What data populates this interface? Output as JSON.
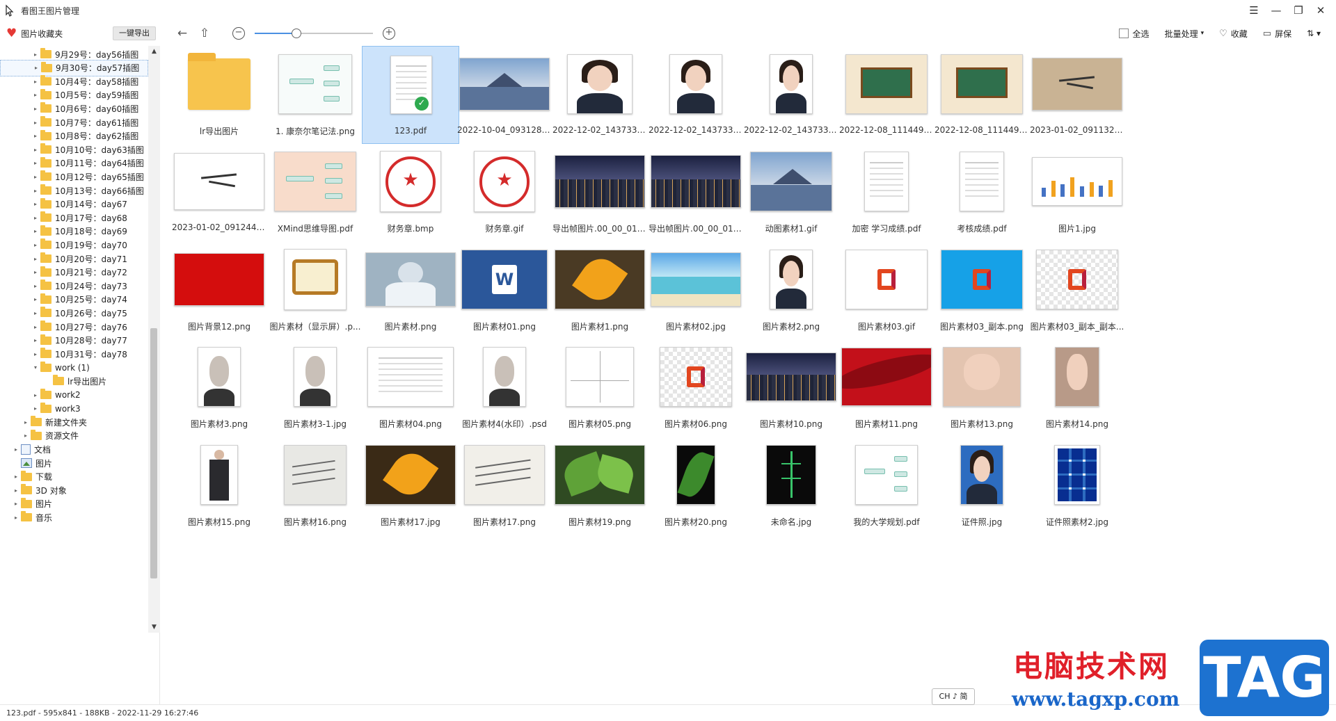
{
  "window": {
    "title": "看图王图片管理",
    "controls": [
      "☰",
      "—",
      "❐",
      "✕"
    ]
  },
  "toolbar": {
    "favorites_label": "图片收藏夹",
    "export_label": "一键导出",
    "zoom_percent": 35,
    "select_all_label": "全选",
    "batch_label": "批量处理",
    "batch_arrow": "▾",
    "collect_label": "收藏",
    "screen_label": "屏保",
    "sort_icon": "⇅ ▾"
  },
  "icons": {
    "back": "←",
    "up": "⇧",
    "zoom_out": "−",
    "zoom_in": "+",
    "heart": "♥",
    "heart_outline": "♡",
    "monitor": "▭",
    "expand": "▸",
    "collapse": "▾",
    "scroll_up": "▲",
    "scroll_down": "▼",
    "check": "✓"
  },
  "tree": [
    {
      "label": "9月29号：day56插图",
      "level": 3,
      "kind": "folder",
      "arrow": "▸"
    },
    {
      "label": "9月30号：day57插图",
      "level": 3,
      "kind": "folder",
      "arrow": "▸",
      "selected": true
    },
    {
      "label": "10月4号：day58插图",
      "level": 3,
      "kind": "folder",
      "arrow": "▸"
    },
    {
      "label": "10月5号：day59插图",
      "level": 3,
      "kind": "folder",
      "arrow": "▸"
    },
    {
      "label": "10月6号：day60插图",
      "level": 3,
      "kind": "folder",
      "arrow": "▸"
    },
    {
      "label": "10月7号：day61插图",
      "level": 3,
      "kind": "folder",
      "arrow": "▸"
    },
    {
      "label": "10月8号：day62插图",
      "level": 3,
      "kind": "folder",
      "arrow": "▸"
    },
    {
      "label": "10月10号：day63插图",
      "level": 3,
      "kind": "folder",
      "arrow": "▸"
    },
    {
      "label": "10月11号：day64插图",
      "level": 3,
      "kind": "folder",
      "arrow": "▸"
    },
    {
      "label": "10月12号：day65插图",
      "level": 3,
      "kind": "folder",
      "arrow": "▸"
    },
    {
      "label": "10月13号：day66插图",
      "level": 3,
      "kind": "folder",
      "arrow": "▸"
    },
    {
      "label": "10月14号：day67",
      "level": 3,
      "kind": "folder",
      "arrow": "▸"
    },
    {
      "label": "10月17号：day68",
      "level": 3,
      "kind": "folder",
      "arrow": "▸"
    },
    {
      "label": "10月18号：day69",
      "level": 3,
      "kind": "folder",
      "arrow": "▸"
    },
    {
      "label": "10月19号：day70",
      "level": 3,
      "kind": "folder",
      "arrow": "▸"
    },
    {
      "label": "10月20号：day71",
      "level": 3,
      "kind": "folder",
      "arrow": "▸"
    },
    {
      "label": "10月21号：day72",
      "level": 3,
      "kind": "folder",
      "arrow": "▸"
    },
    {
      "label": "10月24号：day73",
      "level": 3,
      "kind": "folder",
      "arrow": "▸"
    },
    {
      "label": "10月25号：day74",
      "level": 3,
      "kind": "folder",
      "arrow": "▸"
    },
    {
      "label": "10月26号：day75",
      "level": 3,
      "kind": "folder",
      "arrow": "▸"
    },
    {
      "label": "10月27号：day76",
      "level": 3,
      "kind": "folder",
      "arrow": "▸"
    },
    {
      "label": "10月28号：day77",
      "level": 3,
      "kind": "folder",
      "arrow": "▸"
    },
    {
      "label": "10月31号：day78",
      "level": 3,
      "kind": "folder",
      "arrow": "▸"
    },
    {
      "label": "work (1)",
      "level": 3,
      "kind": "folder",
      "arrow": "▾"
    },
    {
      "label": "lr导出图片",
      "level": 4,
      "kind": "folder",
      "arrow": ""
    },
    {
      "label": "work2",
      "level": 3,
      "kind": "folder",
      "arrow": "▸"
    },
    {
      "label": "work3",
      "level": 3,
      "kind": "folder",
      "arrow": "▸"
    },
    {
      "label": "新建文件夹",
      "level": 2,
      "kind": "folder",
      "arrow": "▸"
    },
    {
      "label": "资源文件",
      "level": 2,
      "kind": "folder",
      "arrow": "▸"
    },
    {
      "label": "文档",
      "level": 1,
      "kind": "doc",
      "arrow": "▸"
    },
    {
      "label": "图片",
      "level": 1,
      "kind": "pic",
      "arrow": ""
    },
    {
      "label": "下载",
      "level": 1,
      "kind": "folder",
      "arrow": "▸"
    },
    {
      "label": "3D 对象",
      "level": 1,
      "kind": "folder",
      "arrow": "▸"
    },
    {
      "label": "图片",
      "level": 1,
      "kind": "folder",
      "arrow": "▸"
    },
    {
      "label": "音乐",
      "level": 1,
      "kind": "folder",
      "arrow": "▸"
    }
  ],
  "files": [
    {
      "name": "lr导出图片",
      "kind": "folder"
    },
    {
      "name": "1. 康奈尔笔记法.png",
      "kind": "mindmap",
      "w": 106,
      "h": 86,
      "bg": "#f7fbfa"
    },
    {
      "name": "123.pdf",
      "kind": "pdf",
      "w": 60,
      "h": 84,
      "bg": "#ffffff",
      "selected": true
    },
    {
      "name": "2022-10-04_093128....",
      "kind": "landscape",
      "w": 136,
      "h": 76,
      "bg": "#6e90b8"
    },
    {
      "name": "2022-12-02_143733 ...",
      "kind": "portrait",
      "w": 94,
      "h": 86,
      "bg": "#ffffff"
    },
    {
      "name": "2022-12-02_143733.j...",
      "kind": "portrait",
      "w": 76,
      "h": 86,
      "bg": "#ffffff"
    },
    {
      "name": "2022-12-02_143733....",
      "kind": "portrait",
      "w": 62,
      "h": 86,
      "bg": "#ffffff"
    },
    {
      "name": "2022-12-08_111449....",
      "kind": "board",
      "w": 118,
      "h": 86,
      "bg": "#f4e7cf"
    },
    {
      "name": "2022-12-08_111449_...",
      "kind": "board",
      "w": 118,
      "h": 86,
      "bg": "#f4e7cf"
    },
    {
      "name": "2023-01-02_091132....",
      "kind": "sign",
      "w": 136,
      "h": 76,
      "bg": "#c9b394"
    },
    {
      "name": "2023-01-02_091244....",
      "kind": "sign",
      "w": 136,
      "h": 82,
      "bg": "#ffffff"
    },
    {
      "name": "XMind思维导图.pdf",
      "kind": "mindmap",
      "w": 118,
      "h": 86,
      "bg": "#f8dccb"
    },
    {
      "name": "财务章.bmp",
      "kind": "stamp",
      "w": 88,
      "h": 88,
      "bg": "#ffffff"
    },
    {
      "name": "财务章.gif",
      "kind": "stamp",
      "w": 88,
      "h": 88,
      "bg": "#ffffff"
    },
    {
      "name": "导出帧图片.00_00_01_...",
      "kind": "city",
      "w": 136,
      "h": 76,
      "bg": "#2c3556"
    },
    {
      "name": "导出帧图片.00_00_01_...",
      "kind": "city",
      "w": 136,
      "h": 76,
      "bg": "#2c3556"
    },
    {
      "name": "动图素材1.gif",
      "kind": "landscape",
      "w": 118,
      "h": 86,
      "bg": "#ffffff"
    },
    {
      "name": "加密 学习成绩.pdf",
      "kind": "pdf",
      "w": 64,
      "h": 86,
      "bg": "#ffffff"
    },
    {
      "name": "考核成绩.pdf",
      "kind": "pdf",
      "w": 64,
      "h": 86,
      "bg": "#ffffff"
    },
    {
      "name": "图片1.jpg",
      "kind": "chart",
      "w": 136,
      "h": 70,
      "bg": "#ffffff"
    },
    {
      "name": "图片背景12.png",
      "kind": "solid",
      "w": 136,
      "h": 76,
      "bg": "#d40d0d"
    },
    {
      "name": "图片素材（显示屏）.p...",
      "kind": "tv",
      "w": 90,
      "h": 88,
      "bg": "#ffffff"
    },
    {
      "name": "图片素材.png",
      "kind": "doctor",
      "w": 136,
      "h": 78,
      "bg": "#9fb3c2"
    },
    {
      "name": "图片素材01.png",
      "kind": "word",
      "w": 124,
      "h": 86,
      "bg": "#2b579a"
    },
    {
      "name": "图片素材1.png",
      "kind": "leaf",
      "w": 136,
      "h": 86,
      "bg": "#4a3a24"
    },
    {
      "name": "图片素材02.jpg",
      "kind": "beach",
      "w": 136,
      "h": 78,
      "bg": "#5bc2d8"
    },
    {
      "name": "图片素材2.png",
      "kind": "portrait",
      "w": 62,
      "h": 86,
      "bg": "#ffffff"
    },
    {
      "name": "图片素材03.gif",
      "kind": "office",
      "w": 118,
      "h": 86,
      "bg": "#ffffff"
    },
    {
      "name": "图片素材03_副本.png",
      "kind": "office",
      "w": 118,
      "h": 86,
      "bg": "#16a1e7"
    },
    {
      "name": "图片素材03_副本_副本...",
      "kind": "officechk",
      "w": 118,
      "h": 86,
      "bg": "#ffffff"
    },
    {
      "name": "图片素材3.png",
      "kind": "elder",
      "w": 62,
      "h": 86,
      "bg": "#ffffff"
    },
    {
      "name": "图片素材3-1.jpg",
      "kind": "elder",
      "w": 62,
      "h": 86,
      "bg": "#ffffff"
    },
    {
      "name": "图片素材04.png",
      "kind": "pdf",
      "w": 124,
      "h": 86,
      "bg": "#ffffff"
    },
    {
      "name": "图片素材4(水印）.psd",
      "kind": "elder",
      "w": 62,
      "h": 86,
      "bg": "#ffffff"
    },
    {
      "name": "图片素材05.png",
      "kind": "graph",
      "w": 98,
      "h": 86,
      "bg": "#ffffff"
    },
    {
      "name": "图片素材06.png",
      "kind": "officechk",
      "w": 104,
      "h": 86,
      "bg": "#ffffff"
    },
    {
      "name": "图片素材10.png",
      "kind": "city",
      "w": 136,
      "h": 70,
      "bg": "#2c3556"
    },
    {
      "name": "图片素材11.png",
      "kind": "silk",
      "w": 136,
      "h": 84,
      "bg": "#c3101a"
    },
    {
      "name": "图片素材13.png",
      "kind": "beauty",
      "w": 112,
      "h": 86,
      "bg": "#e3c4b0"
    },
    {
      "name": "图片素材14.png",
      "kind": "beauty",
      "w": 64,
      "h": 86,
      "bg": "#b89a88"
    },
    {
      "name": "图片素材15.png",
      "kind": "man",
      "w": 54,
      "h": 86,
      "bg": "#ffffff"
    },
    {
      "name": "图片素材16.png",
      "kind": "script",
      "w": 90,
      "h": 86,
      "bg": "#e8e8e4"
    },
    {
      "name": "图片素材17.jpg",
      "kind": "leaf",
      "w": 136,
      "h": 86,
      "bg": "#3a2a16"
    },
    {
      "name": "图片素材17.png",
      "kind": "script",
      "w": 116,
      "h": 86,
      "bg": "#f1efe9"
    },
    {
      "name": "图片素材19.png",
      "kind": "green",
      "w": 136,
      "h": 86,
      "bg": "#2f4a22"
    },
    {
      "name": "图片素材20.png",
      "kind": "darkleaf",
      "w": 56,
      "h": 86,
      "bg": "#0a0a0a"
    },
    {
      "name": "未命名.jpg",
      "kind": "darktree",
      "w": 72,
      "h": 86,
      "bg": "#0a0a0a"
    },
    {
      "name": "我的大学规划.pdf",
      "kind": "mindmap",
      "w": 90,
      "h": 86,
      "bg": "#ffffff"
    },
    {
      "name": "证件照.jpg",
      "kind": "portrait",
      "w": 62,
      "h": 86,
      "bg": "#2d6cc0"
    },
    {
      "name": "证件照素材2.jpg",
      "kind": "idgrid",
      "w": 66,
      "h": 86,
      "bg": "#ffffff"
    }
  ],
  "status": {
    "text": "123.pdf - 595x841 - 188KB - 2022-11-29 16:27:46"
  },
  "ime": {
    "label": "CH ♪ 简"
  },
  "watermark": {
    "title": "电脑技术网",
    "url": "www.tagxp.com",
    "badge": "TAG"
  }
}
